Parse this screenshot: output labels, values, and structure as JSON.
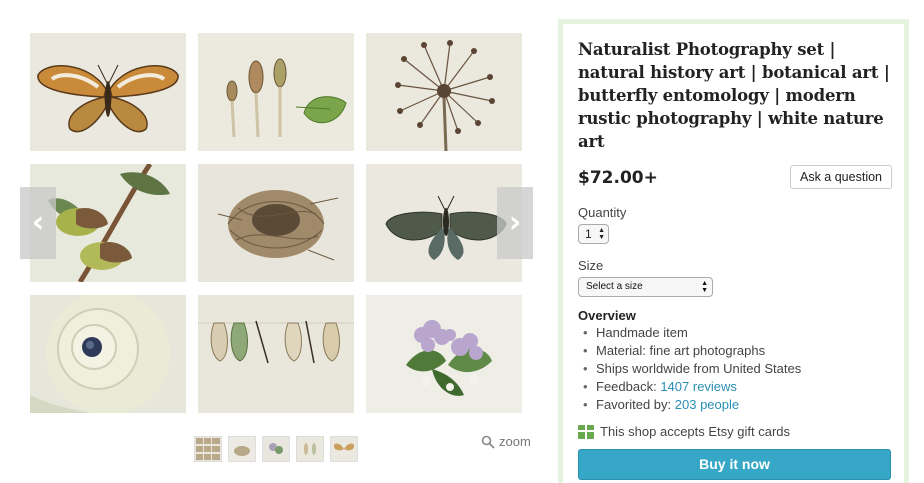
{
  "listing": {
    "title": "Naturalist Photography set | natural history art | botanical art | butterfly entomology | modern rustic photography | white nature art",
    "price": "$72.00+",
    "ask_question_label": "Ask a question",
    "quantity_label": "Quantity",
    "quantity_value": "1",
    "size_label": "Size",
    "size_value": "Select a size",
    "overview_title": "Overview",
    "overview": {
      "handmade": "Handmade item",
      "material": "Material: fine art photographs",
      "ships": "Ships worldwide from United States",
      "feedback_prefix": "Feedback: ",
      "feedback_link": "1407 reviews",
      "favorited_prefix": "Favorited by: ",
      "favorited_link": "203 people"
    },
    "gift_cards_text": "This shop accepts Etsy gift cards",
    "buy_label": "Buy it now"
  },
  "gallery": {
    "zoom_label": "zoom",
    "prev_icon": "chevron-left-icon",
    "next_icon": "chevron-right-icon",
    "tiles": [
      "butterfly",
      "seed-pods-and-leaf",
      "dried-allium-seedhead",
      "acorns-on-branch",
      "bird-nest",
      "dark-butterfly",
      "snail-shell",
      "hanging-chrysalises",
      "lilac-flowers"
    ],
    "thumbs": [
      "collage",
      "nest",
      "flowers",
      "chrysalis",
      "butterfly"
    ]
  },
  "colors": {
    "accent": "#37a7c7",
    "link": "#2a8fb5",
    "panel_border": "#e3f3df",
    "gift_icon": "#6aa84f"
  }
}
